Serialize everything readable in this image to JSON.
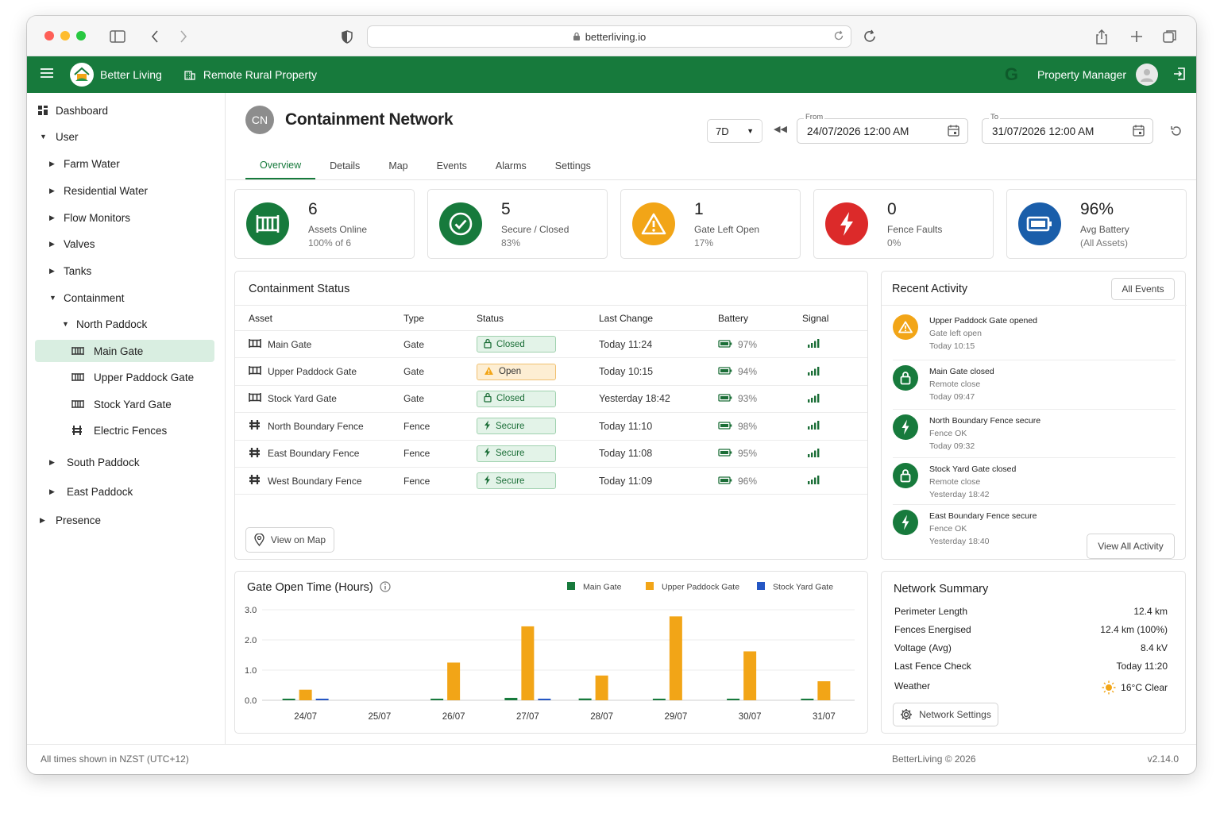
{
  "browser": {
    "url": "betterliving.io"
  },
  "app": {
    "brand": "Better Living",
    "property": "Remote Rural Property",
    "user": "Property Manager"
  },
  "sidebar": {
    "dashboard": "Dashboard",
    "user": "User",
    "farm_water": "Farm Water",
    "residential_water": "Residential Water",
    "flow_monitors": "Flow Monitors",
    "valves": "Valves",
    "tanks": "Tanks",
    "containment": "Containment",
    "north_paddock": "North Paddock",
    "main_gate": "Main Gate",
    "upper_paddock_gate": "Upper Paddock Gate",
    "stock_yard_gate": "Stock Yard Gate",
    "electric_fences": "Electric Fences",
    "south_paddock": "South Paddock",
    "east_paddock": "East Paddock",
    "presence": "Presence"
  },
  "page": {
    "badge": "CN",
    "title": "Containment Network",
    "range": "7D",
    "from_label": "From",
    "from_value": "24/07/2026 12:00 AM",
    "to_label": "To",
    "to_value": "31/07/2026 12:00 AM",
    "tabs": [
      "Overview",
      "Details",
      "Map",
      "Events",
      "Alarms",
      "Settings"
    ]
  },
  "kpis": [
    {
      "value": "6",
      "label": "Assets Online",
      "sub": "100% of 6",
      "color": "#177a3c"
    },
    {
      "value": "5",
      "label": "Secure / Closed",
      "sub": "83%",
      "color": "#177a3c"
    },
    {
      "value": "1",
      "label": "Gate Left Open",
      "sub": "17%",
      "color": "#f2a517"
    },
    {
      "value": "0",
      "label": "Fence Faults",
      "sub": "0%",
      "color": "#dc2a2a"
    },
    {
      "value": "96%",
      "label": "Avg Battery",
      "sub": "(All Assets)",
      "color": "#1a5eaa"
    }
  ],
  "containment": {
    "title": "Containment Status",
    "headers": [
      "Asset",
      "Type",
      "Status",
      "Last Change",
      "Battery",
      "Signal"
    ],
    "rows": [
      {
        "asset": "Main Gate",
        "type": "Gate",
        "status": "Closed",
        "change": "Today 11:24",
        "battery": "97%"
      },
      {
        "asset": "Upper Paddock Gate",
        "type": "Gate",
        "status": "Open",
        "change": "Today 10:15",
        "battery": "94%"
      },
      {
        "asset": "Stock Yard Gate",
        "type": "Gate",
        "status": "Closed",
        "change": "Yesterday 18:42",
        "battery": "93%"
      },
      {
        "asset": "North Boundary Fence",
        "type": "Fence",
        "status": "Secure",
        "change": "Today 11:10",
        "battery": "98%"
      },
      {
        "asset": "East Boundary Fence",
        "type": "Fence",
        "status": "Secure",
        "change": "Today 11:08",
        "battery": "95%"
      },
      {
        "asset": "West Boundary Fence",
        "type": "Fence",
        "status": "Secure",
        "change": "Today 11:09",
        "battery": "96%"
      }
    ],
    "view_map": "View on Map"
  },
  "activity": {
    "title": "Recent Activity",
    "all_events": "All Events",
    "items": [
      {
        "title": "Upper Paddock Gate opened",
        "detail": "Gate left open",
        "time": "Today 10:15"
      },
      {
        "title": "Main Gate closed",
        "detail": "Remote close",
        "time": "Today 09:47"
      },
      {
        "title": "North Boundary Fence secure",
        "detail": "Fence OK",
        "time": "Today 09:32"
      },
      {
        "title": "Stock Yard Gate closed",
        "detail": "Remote close",
        "time": "Yesterday 18:42"
      },
      {
        "title": "East Boundary Fence secure",
        "detail": "Fence OK",
        "time": "Yesterday 18:40"
      }
    ],
    "view_all": "View All Activity"
  },
  "chart_data": {
    "type": "bar",
    "title": "Gate Open Time (Hours)",
    "categories": [
      "24/07",
      "25/07",
      "26/07",
      "27/07",
      "28/07",
      "29/07",
      "30/07",
      "31/07"
    ],
    "series": [
      {
        "name": "Main Gate",
        "color": "#177a3c",
        "values": [
          0.05,
          0,
          0.05,
          0.08,
          0.06,
          0.05,
          0.05,
          0.03
        ]
      },
      {
        "name": "Upper Paddock Gate",
        "color": "#f2a517",
        "values": [
          0.35,
          0,
          1.25,
          2.45,
          0.82,
          2.78,
          1.62,
          0.63
        ]
      },
      {
        "name": "Stock Yard Gate",
        "color": "#2456c4",
        "values": [
          0.03,
          0,
          0,
          0.03,
          0,
          0,
          0,
          0
        ]
      }
    ],
    "yticks": [
      "3.0",
      "2.0",
      "1.0",
      "0.0"
    ],
    "ylim": [
      0,
      3
    ],
    "grid": true,
    "legend": "top-right"
  },
  "summary": {
    "title": "Network Summary",
    "rows": [
      {
        "label": "Perimeter Length",
        "value": "12.4 km"
      },
      {
        "label": "Fences Energised",
        "value": "12.4 km (100%)"
      },
      {
        "label": "Voltage (Avg)",
        "value": "8.4 kV"
      },
      {
        "label": "Last Fence Check",
        "value": "Today 11:20"
      },
      {
        "label": "Weather",
        "value": "16°C Clear"
      }
    ],
    "settings": "Network Settings"
  },
  "footer": {
    "timezone": "All times shown in NZST (UTC+12)",
    "copyright": "BetterLiving © 2026",
    "version": "v2.14.0"
  }
}
